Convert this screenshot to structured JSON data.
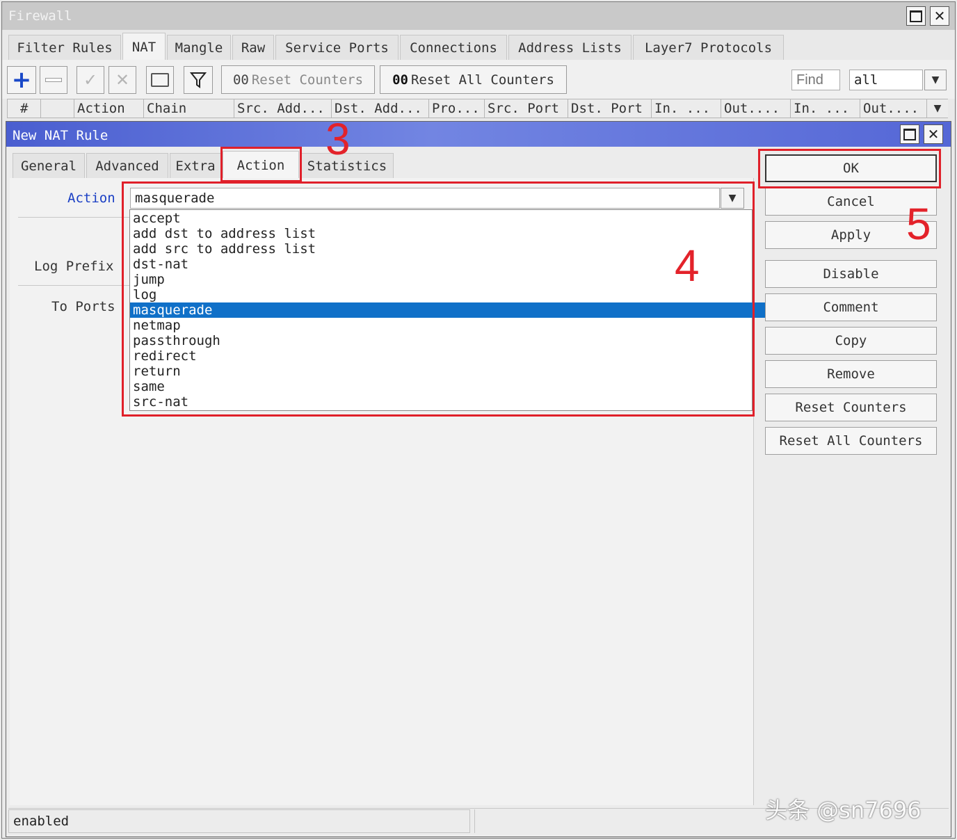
{
  "window": {
    "title": "Firewall"
  },
  "tabs": [
    {
      "label": "Filter Rules"
    },
    {
      "label": "NAT"
    },
    {
      "label": "Mangle"
    },
    {
      "label": "Raw"
    },
    {
      "label": "Service Ports"
    },
    {
      "label": "Connections"
    },
    {
      "label": "Address Lists"
    },
    {
      "label": "Layer7 Protocols"
    }
  ],
  "toolbar": {
    "reset_counters_prefix": "00",
    "reset_counters": "Reset Counters",
    "reset_all_prefix": "00",
    "reset_all_counters": "Reset All Counters",
    "find_placeholder": "Find",
    "filter_value": "all"
  },
  "columns": [
    "#",
    "Action",
    "Chain",
    "Src. Add...",
    "Dst. Add...",
    "Pro...",
    "Src. Port",
    "Dst. Port",
    "In. ...",
    "Out....",
    "In. ...",
    "Out...."
  ],
  "dialog": {
    "title": "New NAT Rule",
    "tabs": [
      {
        "label": "General"
      },
      {
        "label": "Advanced"
      },
      {
        "label": "Extra"
      },
      {
        "label": "Action"
      },
      {
        "label": "Statistics"
      }
    ],
    "fields": {
      "action_label": "Action",
      "action_value": "masquerade",
      "log_prefix_label": "Log Prefix",
      "to_ports_label": "To Ports"
    },
    "dropdown_options": [
      "accept",
      "add dst to address list",
      "add src to address list",
      "dst-nat",
      "jump",
      "log",
      "masquerade",
      "netmap",
      "passthrough",
      "redirect",
      "return",
      "same",
      "src-nat"
    ],
    "selected_option": "masquerade",
    "buttons": {
      "ok": "OK",
      "cancel": "Cancel",
      "apply": "Apply",
      "disable": "Disable",
      "comment": "Comment",
      "copy": "Copy",
      "remove": "Remove",
      "reset_counters": "Reset Counters",
      "reset_all_counters": "Reset All Counters"
    },
    "status": "enabled"
  },
  "annotations": {
    "step3": "3",
    "step4": "4",
    "step5": "5",
    "watermark": "头条 @sn7696"
  }
}
